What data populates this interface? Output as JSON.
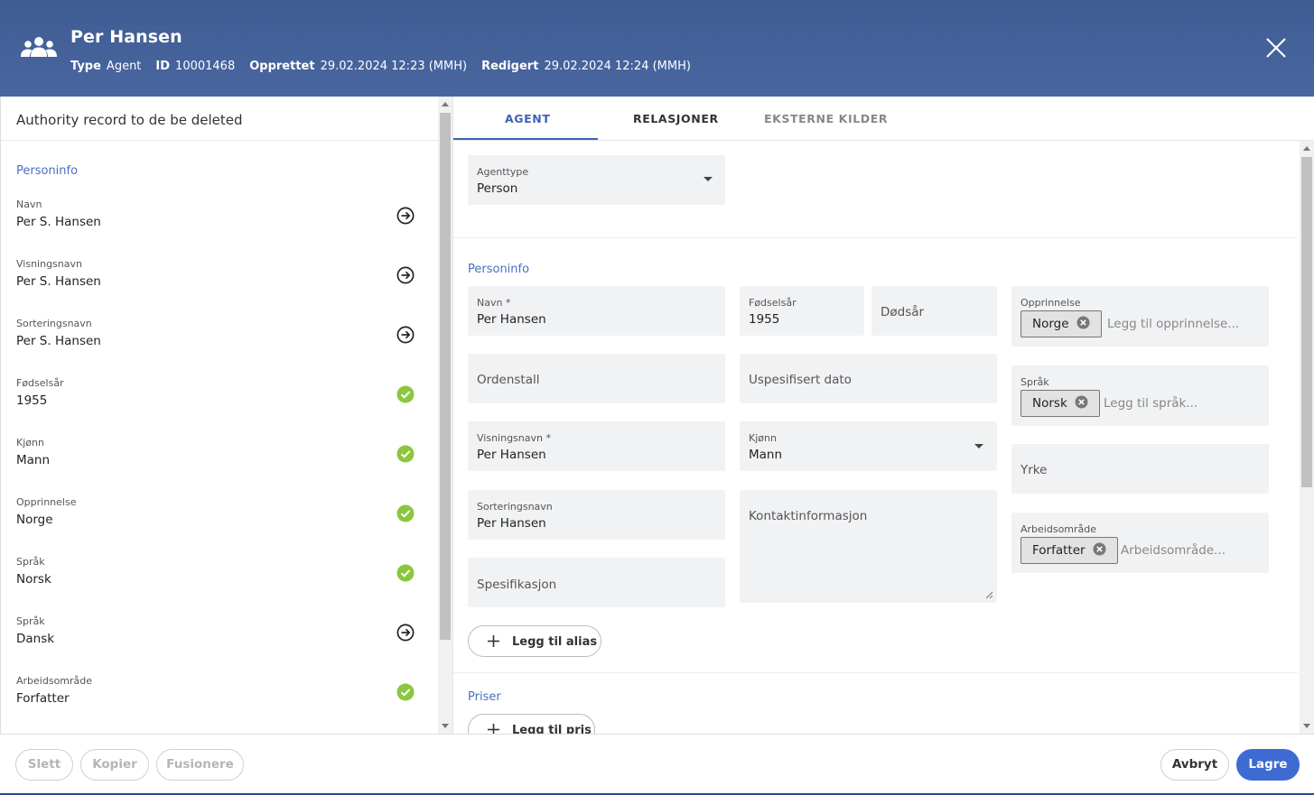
{
  "header": {
    "title": "Per Hansen",
    "type_label": "Type",
    "type_value": "Agent",
    "id_label": "ID",
    "id_value": "10001468",
    "created_label": "Opprettet",
    "created_value": "29.02.2024 12:23 (MMH)",
    "edited_label": "Redigert",
    "edited_value": "29.02.2024 12:24 (MMH)",
    "icon": "people-group-icon",
    "close_icon": "close-icon"
  },
  "left": {
    "title": "Authority record to de be deleted",
    "section": "Personinfo",
    "items": [
      {
        "label": "Navn",
        "value": "Per S. Hansen",
        "status": "arrow"
      },
      {
        "label": "Visningsnavn",
        "value": "Per S. Hansen",
        "status": "arrow"
      },
      {
        "label": "Sorteringsnavn",
        "value": "Per S. Hansen",
        "status": "arrow"
      },
      {
        "label": "Fødselsår",
        "value": "1955",
        "status": "check"
      },
      {
        "label": "Kjønn",
        "value": "Mann",
        "status": "check"
      },
      {
        "label": "Opprinnelse",
        "value": "Norge",
        "status": "check"
      },
      {
        "label": "Språk",
        "value": "Norsk",
        "status": "check"
      },
      {
        "label": "Språk",
        "value": "Dansk",
        "status": "arrow"
      },
      {
        "label": "Arbeidsområde",
        "value": "Forfatter",
        "status": "check"
      }
    ],
    "check_color": "#8cc63f"
  },
  "tabs": {
    "agent": "AGENT",
    "relations": "RELASJONER",
    "external": "EKSTERNE KILDER"
  },
  "form": {
    "agenttype_label": "Agenttype",
    "agenttype_value": "Person",
    "section_personinfo": "Personinfo",
    "name_label": "Navn *",
    "name_value": "Per Hansen",
    "birth_label": "Fødselsår",
    "birth_value": "1955",
    "death_placeholder": "Dødsår",
    "origin_label": "Opprinnelse",
    "origin_chip": "Norge",
    "origin_placeholder": "Legg til opprinnelse...",
    "ordinal_placeholder": "Ordenstall",
    "unspec_date_placeholder": "Uspesifisert dato",
    "language_label": "Språk",
    "language_chip": "Norsk",
    "language_placeholder": "Legg til språk...",
    "display_name_label": "Visningsnavn *",
    "display_name_value": "Per Hansen",
    "gender_label": "Kjønn",
    "gender_value": "Mann",
    "profession_placeholder": "Yrke",
    "sort_name_label": "Sorteringsnavn",
    "sort_name_value": "Per Hansen",
    "contact_placeholder": "Kontaktinformasjon",
    "work_area_label": "Arbeidsområde",
    "work_area_chip": "Forfatter",
    "work_area_placeholder": "Arbeidsområde...",
    "specification_placeholder": "Spesifikasjon",
    "add_alias": "Legg til alias",
    "section_awards": "Priser",
    "add_award": "Legg til pris"
  },
  "footer": {
    "delete": "Slett",
    "copy": "Kopier",
    "merge": "Fusionere",
    "cancel": "Avbryt",
    "save": "Lagre"
  },
  "colors": {
    "header": "#4560a0",
    "accent": "#3d63b8",
    "primary_button": "#3d6bd1"
  }
}
